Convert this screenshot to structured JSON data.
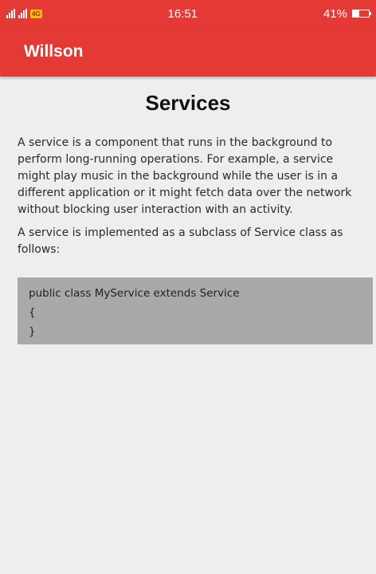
{
  "status_bar": {
    "carrier_badge": "4G",
    "time": "16:51",
    "battery": "41%",
    "battery_level": 0.41
  },
  "app_bar": {
    "title": "Willson"
  },
  "page": {
    "title": "Services",
    "paragraphs": [
      "A service is a component that runs in the background to perform long-running operations. For example, a service might play music in the background while the user is in a different application or it might fetch data over the network without blocking user interaction with an activity.",
      "A service is implemented as a subclass of Service class as follows:"
    ],
    "code_lines": [
      "public class MyService extends Service",
      "{",
      "}"
    ]
  }
}
